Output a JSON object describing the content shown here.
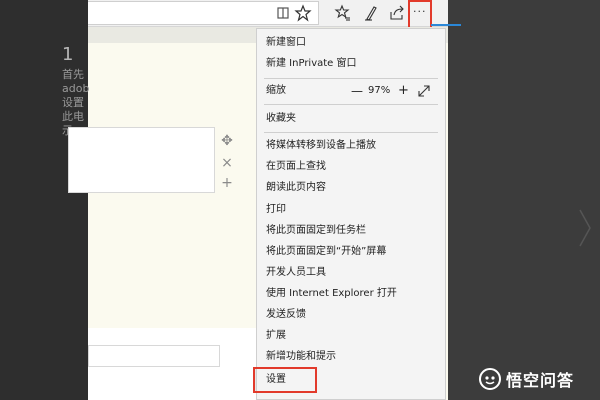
{
  "page": {
    "step_number": "1",
    "step_text_lines": [
      "首先",
      "adob",
      "设置",
      "此电",
      "示"
    ]
  },
  "menu": {
    "items": [
      {
        "label": "新建窗口"
      },
      {
        "label": "新建 InPrivate 窗口"
      },
      {
        "label": "缩放"
      },
      {
        "label": "收藏夹"
      },
      {
        "label": "将媒体转移到设备上播放"
      },
      {
        "label": "在页面上查找"
      },
      {
        "label": "朗读此页内容"
      },
      {
        "label": "打印"
      },
      {
        "label": "将此页面固定到任务栏"
      },
      {
        "label": "将此页面固定到“开始”屏幕"
      },
      {
        "label": "开发人员工具"
      },
      {
        "label": "使用 Internet Explorer 打开"
      },
      {
        "label": "发送反馈"
      },
      {
        "label": "扩展"
      },
      {
        "label": "新增功能和提示"
      },
      {
        "label": "设置"
      }
    ],
    "zoom": {
      "minus": "—",
      "value": "97%",
      "plus": "+"
    }
  },
  "toolbar": {
    "more_label": "···"
  },
  "side_icons": {
    "move": "✥",
    "close": "×",
    "add": "+"
  },
  "watermark": {
    "text": "悟空问答"
  },
  "colors": {
    "highlight_border": "#e23a2b",
    "accent_blue": "#2b88d8"
  }
}
